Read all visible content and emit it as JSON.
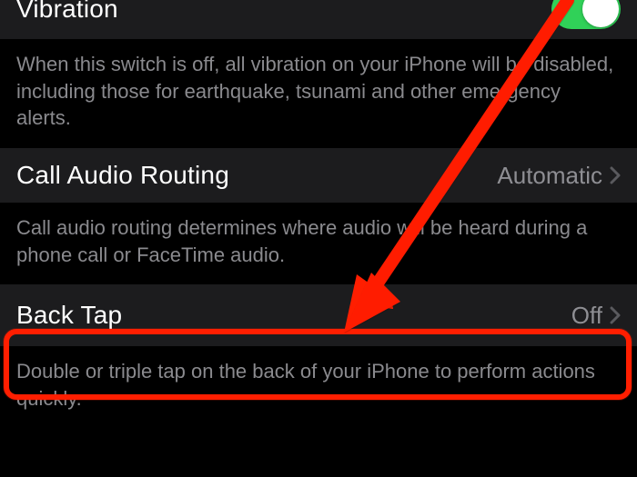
{
  "rows": {
    "vibration": {
      "label": "Vibration",
      "toggle_on": true,
      "footer": "When this switch is off, all vibration on your iPhone will be disabled, including those for earthquake, tsunami and other emergency alerts."
    },
    "call_audio_routing": {
      "label": "Call Audio Routing",
      "value": "Automatic",
      "footer": "Call audio routing determines where audio will be heard during a phone call or FaceTime audio."
    },
    "back_tap": {
      "label": "Back Tap",
      "value": "Off",
      "footer": "Double or triple tap on the back of your iPhone to perform actions quickly."
    }
  },
  "annotation": {
    "highlight_target": "back_tap",
    "highlight_color": "#ff1e00",
    "arrow_from": "top-right",
    "arrow_to": "back_tap_row"
  }
}
